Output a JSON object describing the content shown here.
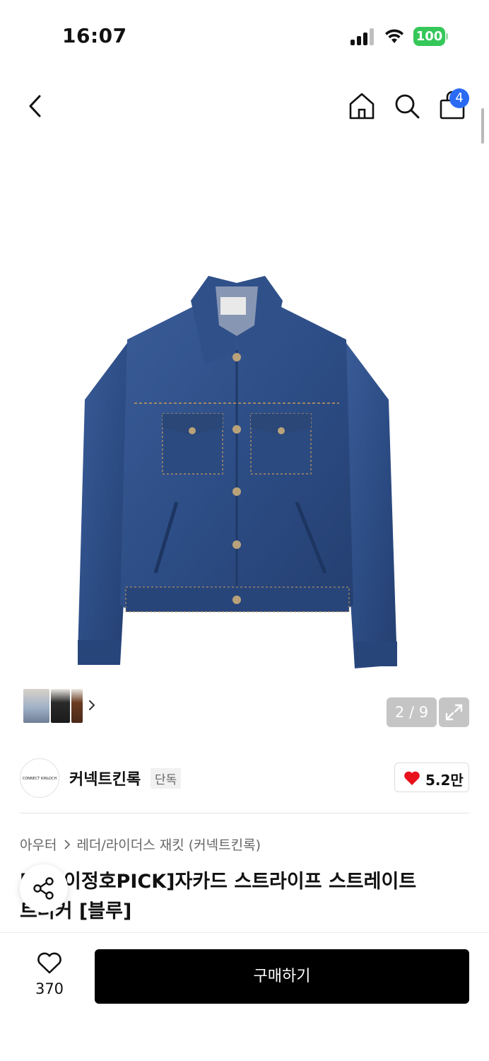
{
  "status_bar": {
    "time": "16:07",
    "battery": "100"
  },
  "header": {
    "cart_count": "4"
  },
  "gallery": {
    "counter": "2 / 9"
  },
  "brand": {
    "logo_text": "CONNECT KINLOCH",
    "name": "커넥트킨록",
    "badge": "단독",
    "likes": "5.2만"
  },
  "breadcrumb": {
    "level1": "아우터",
    "level2": "레더/라이더스 재킷 (커넥트킨록)"
  },
  "product": {
    "title": "[남가이정호PICK]자카드 스트라이프 스트레이트 트러커 [블루]"
  },
  "bottom": {
    "wish_count": "370",
    "buy_label": "구매하기"
  },
  "colors": {
    "accent_badge": "#2b6bf3",
    "battery": "#35c759",
    "heart": "#e8121c",
    "denim": "#2f4f86"
  },
  "icons": [
    "back-icon",
    "home-icon",
    "search-icon",
    "shopping-bag-icon",
    "expand-icon",
    "heart-icon",
    "share-icon",
    "chevron-right-icon"
  ]
}
